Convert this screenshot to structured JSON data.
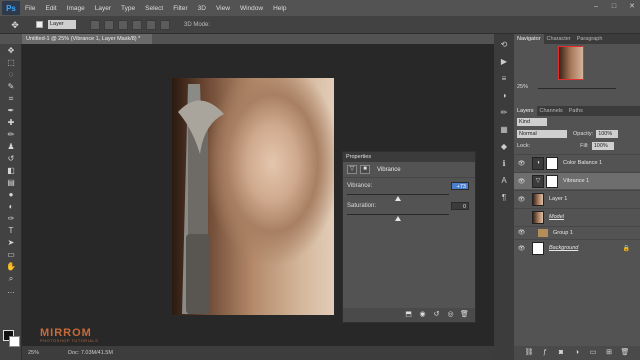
{
  "app": {
    "logo": "Ps"
  },
  "menu": [
    "File",
    "Edit",
    "Image",
    "Layer",
    "Type",
    "Select",
    "Filter",
    "3D",
    "View",
    "Window",
    "Help"
  ],
  "window_buttons": [
    "–",
    "□",
    "✕"
  ],
  "options": {
    "auto_select_value": "Layer",
    "mode_3d_label": "3D Mode:"
  },
  "document": {
    "tab_title": "Untitled-1 @ 25% (Vibrance 1, Layer Mask/8) *",
    "zoom": "25%",
    "doc_info": "Doc: 7.03M/41.5M"
  },
  "properties": {
    "header": "Properties",
    "title": "Vibrance",
    "vibrance": {
      "label": "Vibrance:",
      "value": "+73",
      "fraction": 0.5
    },
    "saturation": {
      "label": "Saturation:",
      "value": "0",
      "fraction": 0.5
    }
  },
  "watermark": {
    "brand": "MIRROM",
    "tagline": "PHOTOSHOP TUTORIALS"
  },
  "navigator": {
    "tabs": [
      "Navigator",
      "Character",
      "Paragraph"
    ],
    "zoom": "25%"
  },
  "layers_panel": {
    "tabs": [
      "Layers",
      "Channels",
      "Paths"
    ],
    "filter_kind": "Kind",
    "blend_mode": "Normal",
    "opacity_label": "Opacity:",
    "opacity": "100%",
    "lock_label": "Lock:",
    "fill_label": "Fill:",
    "fill": "100%",
    "layers": [
      {
        "name": "Color Balance 1",
        "type": "adjustment",
        "selected": false
      },
      {
        "name": "Vibrance 1",
        "type": "adjustment",
        "selected": true
      },
      {
        "name": "Layer 1",
        "type": "pixel",
        "selected": false
      },
      {
        "name": "Model",
        "type": "photo",
        "selected": false
      },
      {
        "name": "Group 1",
        "type": "group",
        "selected": false
      },
      {
        "name": "Background",
        "type": "background",
        "selected": false
      }
    ]
  },
  "colors": {
    "accent": "#4a7fd0",
    "watermark": "#c76b3a",
    "nav_frame": "#e03030"
  }
}
